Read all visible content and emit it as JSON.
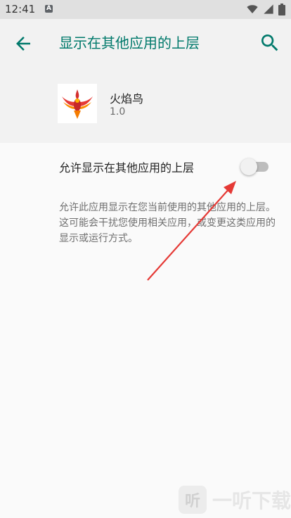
{
  "status_bar": {
    "time": "12:41",
    "notification_letter": "A",
    "icons": [
      "wifi-icon",
      "signal-icon",
      "battery-icon"
    ]
  },
  "app_bar": {
    "title": "显示在其他应用的上层",
    "back_icon": "arrow-back-icon",
    "search_icon": "search-icon",
    "title_color": "#00796b"
  },
  "app_info": {
    "name": "火焰鸟",
    "version": "1.0",
    "icon": "phoenix-app-icon"
  },
  "preference": {
    "label": "允许显示在其他应用的上层",
    "toggle_on": false
  },
  "description": "允许此应用显示在您当前使用的其他应用的上层。这可能会干扰您使用相关应用，或变更这类应用的显示或运行方式。",
  "annotation": {
    "arrow_color": "#e53935"
  },
  "watermark": {
    "logo_glyph": "听",
    "text": "一听下载"
  }
}
